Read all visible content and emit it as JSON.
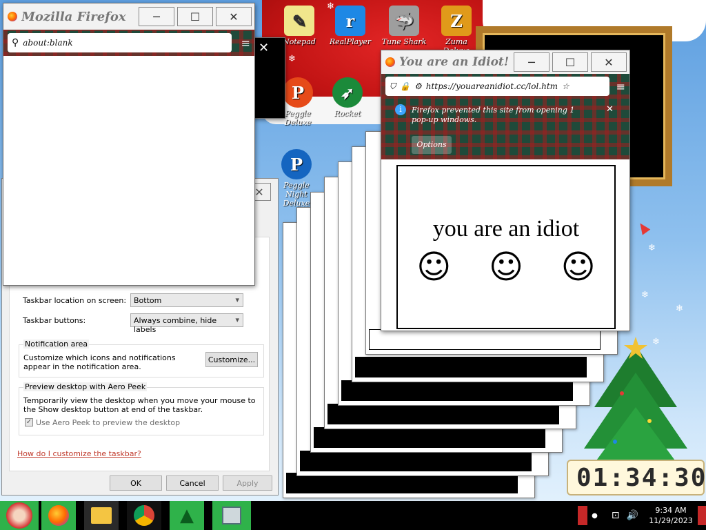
{
  "desktop": {
    "icons": [
      {
        "label": "Notepad",
        "glyph": "✎",
        "color": "#f0e68c"
      },
      {
        "label": "RealPlayer",
        "glyph": "r",
        "color": "#1e88e5"
      },
      {
        "label": "Tune Shark",
        "glyph": "🦈",
        "color": "#9e9e9e"
      },
      {
        "label": "Zuma Deluxe",
        "glyph": "Z",
        "color": "#e09a1a"
      },
      {
        "label": "Peggle Deluxe",
        "glyph": "P",
        "color": "#e64a19"
      },
      {
        "label": "Rocket",
        "glyph": "➶",
        "color": "#1b8a3a"
      },
      {
        "label": "Peggle Night",
        "glyph": "P",
        "color": "#1565c0"
      },
      {
        "label": "Deluxe",
        "glyph": "",
        "color": "#000000"
      }
    ],
    "clock_widget": "01:34:30"
  },
  "firefox_blank": {
    "title": "Mozilla Firefox",
    "url": "about:blank"
  },
  "taskbar_settings": {
    "location_label": "Taskbar location on screen:",
    "location_value": "Bottom",
    "buttons_label": "Taskbar buttons:",
    "buttons_value": "Always combine, hide labels",
    "notification_title": "Notification area",
    "notification_text": "Customize which icons and notifications appear in the notification area.",
    "customize_label": "Customize...",
    "aero_title": "Preview desktop with Aero Peek",
    "aero_text": "Temporarily view the desktop when you move your mouse to the Show desktop button at end of the taskbar.",
    "aero_checkbox": "Use Aero Peek to preview the desktop",
    "help_link": "How do I customize the taskbar?",
    "ok": "OK",
    "cancel": "Cancel",
    "apply": "Apply"
  },
  "idiot_window": {
    "title": "You are an Idiot! ...",
    "url": "https://youareanidiot.cc/lol.htm",
    "notice": "Firefox prevented this site from opening 1 pop-up windows.",
    "options": "Options",
    "headline": "you are an idiot",
    "smiley": "☺"
  },
  "taskbar": {
    "time": "9:34 AM",
    "date": "11/29/2023"
  }
}
